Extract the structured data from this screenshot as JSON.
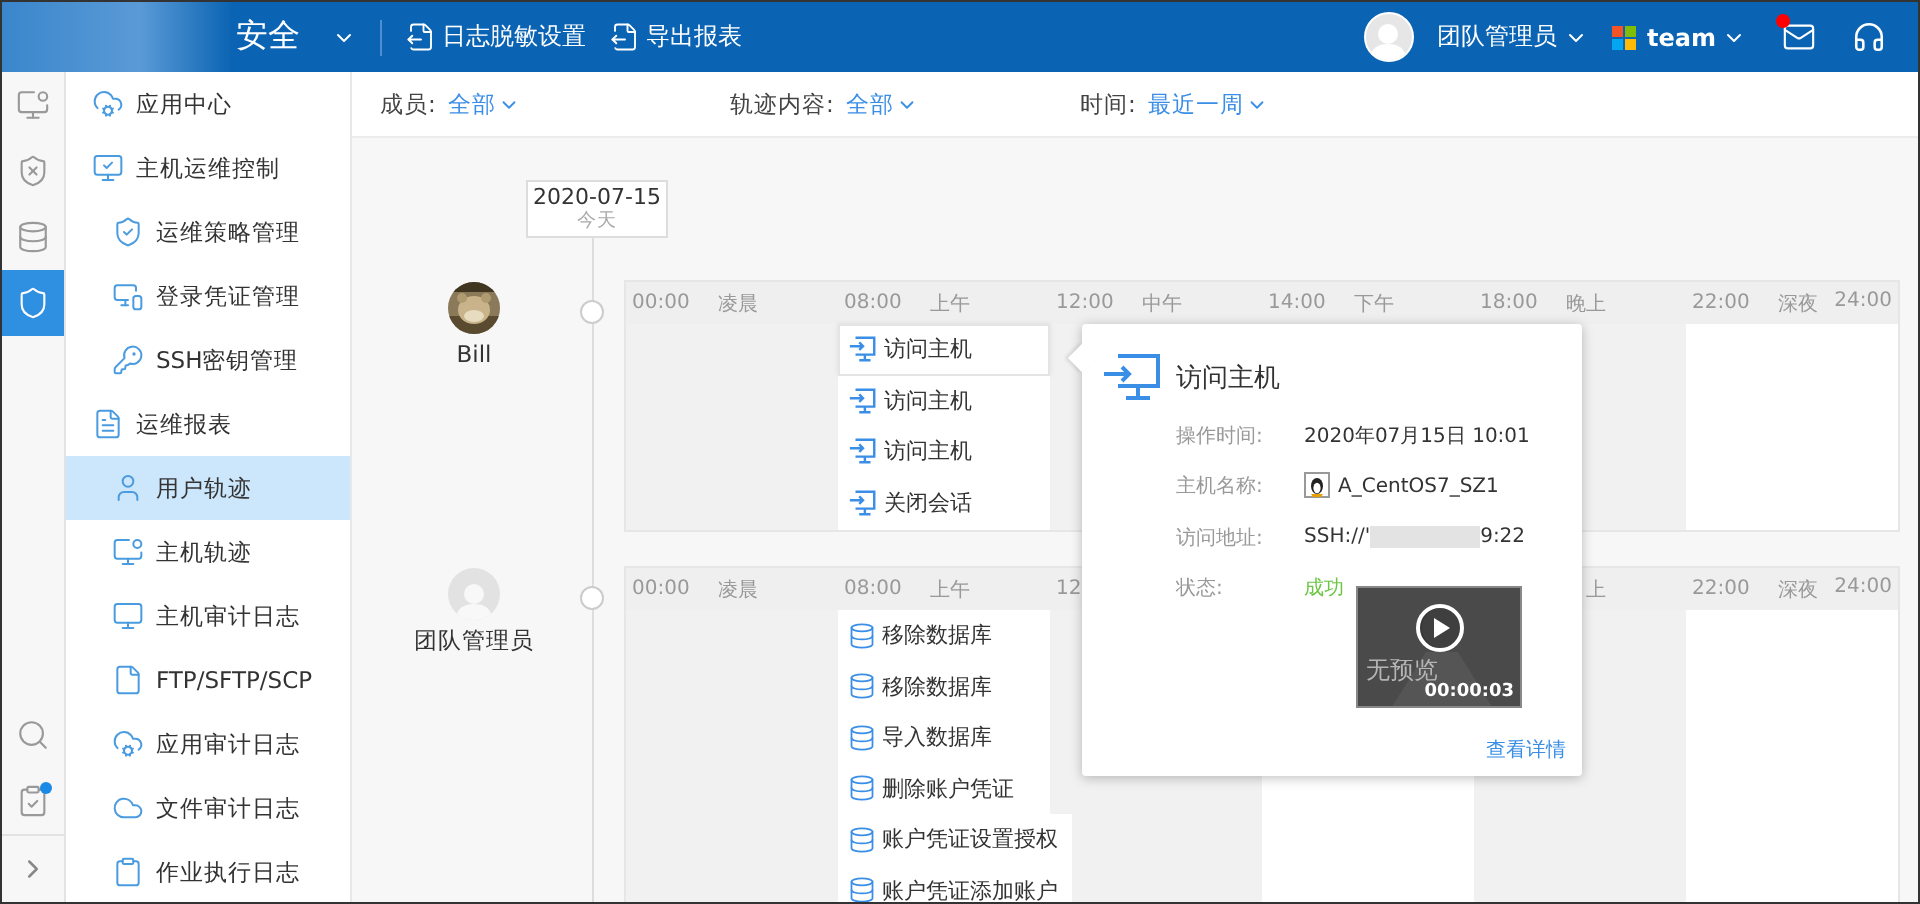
{
  "header": {
    "brand": "安全",
    "actions": [
      {
        "label": "日志脱敏设置"
      },
      {
        "label": "导出报表"
      }
    ],
    "user": "团队管理员",
    "team": "team",
    "mail_unread": true
  },
  "rail": [
    {
      "kind": "monitor",
      "selected": false
    },
    {
      "kind": "shield-x",
      "selected": false
    },
    {
      "kind": "database",
      "selected": false
    },
    {
      "kind": "shield",
      "selected": true
    }
  ],
  "rail_bottom": [
    {
      "kind": "search",
      "badge": false
    },
    {
      "kind": "clipboard",
      "badge": true
    }
  ],
  "sidebar": {
    "items": [
      {
        "label": "应用中心",
        "kind": "cloud-cog",
        "selected": false
      },
      {
        "label": "主机运维控制",
        "kind": "monitor-check",
        "selected": false,
        "children": [
          {
            "label": "运维策略管理",
            "kind": "shield-check",
            "selected": false
          },
          {
            "label": "登录凭证管理",
            "kind": "monitor-link",
            "selected": false
          },
          {
            "label": "SSH密钥管理",
            "kind": "key",
            "selected": false
          }
        ]
      },
      {
        "label": "运维报表",
        "kind": "report",
        "selected": false,
        "children": [
          {
            "label": "用户轨迹",
            "kind": "user",
            "selected": true
          },
          {
            "label": "主机轨迹",
            "kind": "monitor-dot",
            "selected": false
          },
          {
            "label": "主机审计日志",
            "kind": "monitor",
            "selected": false
          },
          {
            "label": "FTP/SFTP/SCP",
            "kind": "file",
            "selected": false
          },
          {
            "label": "应用审计日志",
            "kind": "cloud-cog",
            "selected": false
          },
          {
            "label": "文件审计日志",
            "kind": "cloud",
            "selected": false
          },
          {
            "label": "作业执行日志",
            "kind": "clipboard",
            "selected": false
          }
        ]
      }
    ]
  },
  "filters": [
    {
      "label": "成员:",
      "value": "全部"
    },
    {
      "label": "轨迹内容:",
      "value": "全部"
    },
    {
      "label": "时间:",
      "value": "最近一周"
    }
  ],
  "timeline": {
    "date": "2020-07-15",
    "date_note": "今天",
    "members": [
      {
        "name": "Bill",
        "end_time": "24:00",
        "columns": [
          {
            "time": "00:00",
            "period": "凌晨"
          },
          {
            "time": "08:00",
            "period": "上午"
          },
          {
            "time": "12:00",
            "period": "中午"
          },
          {
            "time": "14:00",
            "period": "下午"
          },
          {
            "time": "18:00",
            "period": "晚上"
          },
          {
            "time": "22:00",
            "period": "深夜"
          }
        ],
        "events": [
          {
            "label": "访问主机",
            "kind": "session",
            "selected": true
          },
          {
            "label": "访问主机",
            "kind": "session",
            "selected": false
          },
          {
            "label": "访问主机",
            "kind": "session",
            "selected": false
          },
          {
            "label": "关闭会话",
            "kind": "session",
            "selected": false
          }
        ]
      },
      {
        "name": "团队管理员",
        "kind": "default",
        "end_time": "24:00",
        "columns": [
          {
            "time": "00:00",
            "period": "凌晨"
          },
          {
            "time": "08:00",
            "period": "上午"
          },
          {
            "time": "12"
          },
          {
            "covered": true
          },
          {
            "period": "上",
            "partial": true
          },
          {
            "time": "22:00",
            "period": "深夜"
          }
        ],
        "events": [
          {
            "label": "移除数据库",
            "kind": "database",
            "selected": false
          },
          {
            "label": "移除数据库",
            "kind": "database",
            "selected": false
          },
          {
            "label": "导入数据库",
            "kind": "database",
            "selected": false
          },
          {
            "label": "删除账户凭证",
            "kind": "database",
            "selected": false
          },
          {
            "label": "账户凭证设置授权",
            "kind": "database",
            "selected": false
          },
          {
            "label": "账户凭证添加账户",
            "kind": "database",
            "selected": false
          }
        ]
      }
    ]
  },
  "popup": {
    "title": "访问主机",
    "rows": [
      {
        "kind": "text",
        "label": "操作时间:",
        "value": "2020年07月15日 10:01"
      },
      {
        "kind": "host",
        "label": "主机名称:",
        "value": "A_CentOS7_SZ1"
      },
      {
        "kind": "address",
        "label": "访问地址:",
        "prefix": "SSH://'",
        "suffix": "9:22",
        "redacted": true
      },
      {
        "kind": "status",
        "label": "状态:",
        "value": "成功"
      }
    ],
    "preview": {
      "watermark": "无预览",
      "duration": "00:00:03"
    },
    "link": "查看详情"
  }
}
